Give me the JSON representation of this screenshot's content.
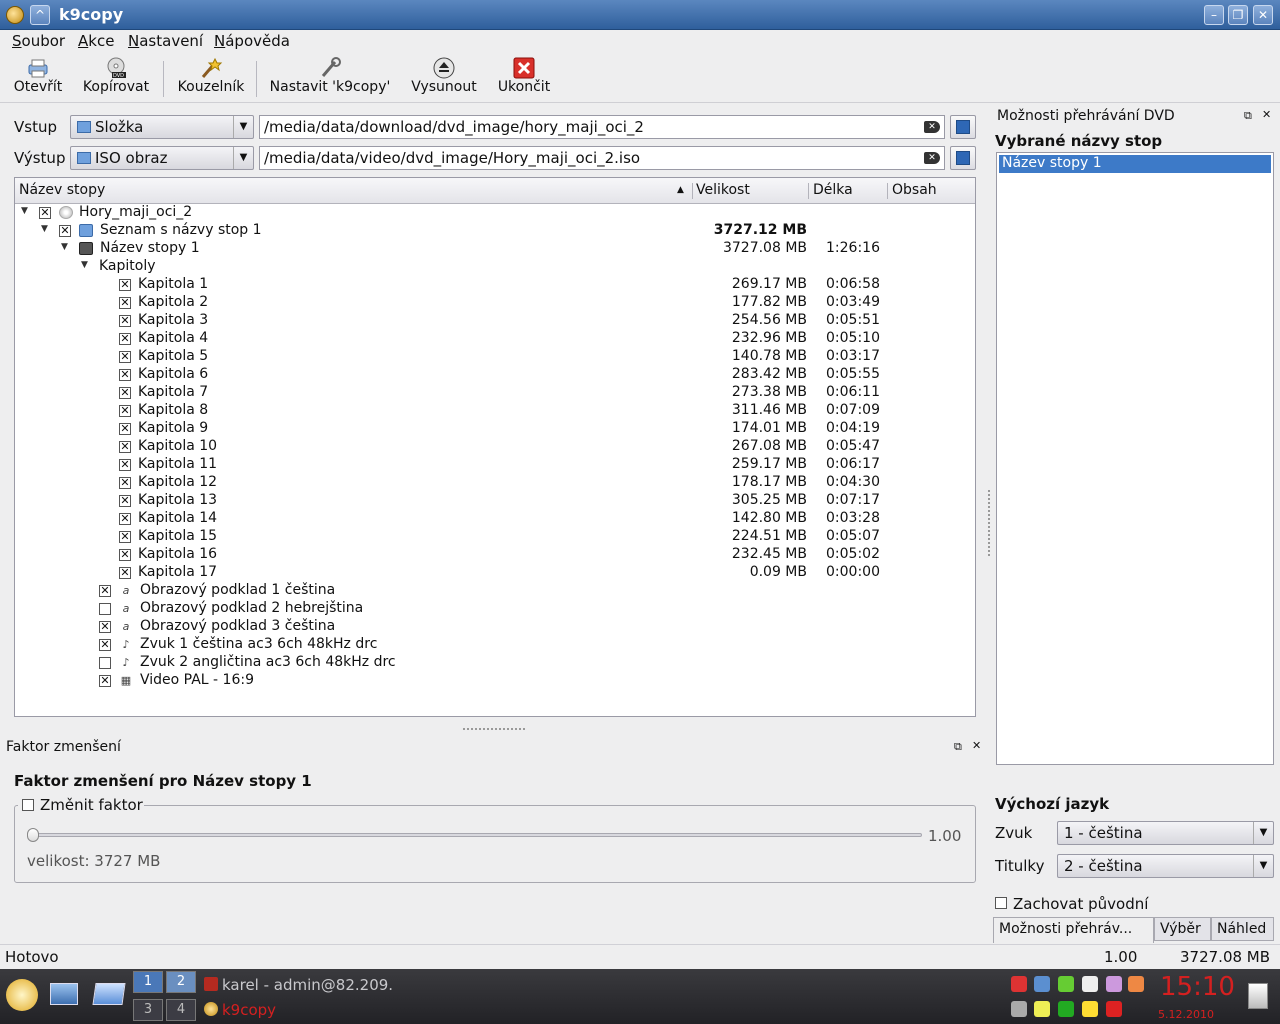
{
  "window": {
    "title": "k9copy"
  },
  "menu": [
    "Soubor",
    "Akce",
    "Nastavení",
    "Nápověda"
  ],
  "toolbar": {
    "open": "Otevřít",
    "copy": "Kopírovat",
    "wizard": "Kouzelník",
    "configure": "Nastavit 'k9copy'",
    "eject": "Vysunout",
    "quit": "Ukončit"
  },
  "io": {
    "input_label": "Vstup",
    "input_type": "Složka",
    "input_path": "/media/data/download/dvd_image/hory_maji_oci_2",
    "output_label": "Výstup",
    "output_type": "ISO obraz",
    "output_path": "/media/data/video/dvd_image/Hory_maji_oci_2.iso"
  },
  "tree": {
    "headers": {
      "name": "Název stopy",
      "size": "Velikost",
      "length": "Délka",
      "content": "Obsah"
    },
    "root": "Hory_maji_oci_2",
    "titleset": {
      "name": "Seznam s názvy stop 1",
      "size": "3727.12 MB"
    },
    "title": {
      "name": "Název stopy 1",
      "size": "3727.08 MB",
      "length": "1:26:16"
    },
    "chapters_label": "Kapitoly",
    "chapters": [
      {
        "name": "Kapitola 1",
        "size": "269.17 MB",
        "length": "0:06:58"
      },
      {
        "name": "Kapitola 2",
        "size": "177.82 MB",
        "length": "0:03:49"
      },
      {
        "name": "Kapitola 3",
        "size": "254.56 MB",
        "length": "0:05:51"
      },
      {
        "name": "Kapitola 4",
        "size": "232.96 MB",
        "length": "0:05:10"
      },
      {
        "name": "Kapitola 5",
        "size": "140.78 MB",
        "length": "0:03:17"
      },
      {
        "name": "Kapitola 6",
        "size": "283.42 MB",
        "length": "0:05:55"
      },
      {
        "name": "Kapitola 7",
        "size": "273.38 MB",
        "length": "0:06:11"
      },
      {
        "name": "Kapitola 8",
        "size": "311.46 MB",
        "length": "0:07:09"
      },
      {
        "name": "Kapitola 9",
        "size": "174.01 MB",
        "length": "0:04:19"
      },
      {
        "name": "Kapitola 10",
        "size": "267.08 MB",
        "length": "0:05:47"
      },
      {
        "name": "Kapitola 11",
        "size": "259.17 MB",
        "length": "0:06:17"
      },
      {
        "name": "Kapitola 12",
        "size": "178.17 MB",
        "length": "0:04:30"
      },
      {
        "name": "Kapitola 13",
        "size": "305.25 MB",
        "length": "0:07:17"
      },
      {
        "name": "Kapitola 14",
        "size": "142.80 MB",
        "length": "0:03:28"
      },
      {
        "name": "Kapitola 15",
        "size": "224.51 MB",
        "length": "0:05:07"
      },
      {
        "name": "Kapitola 16",
        "size": "232.45 MB",
        "length": "0:05:02"
      },
      {
        "name": "Kapitola 17",
        "size": "0.09 MB",
        "length": "0:00:00"
      }
    ],
    "streams": [
      {
        "name": "Obrazový podklad 1 čeština",
        "checked": true
      },
      {
        "name": "Obrazový podklad 2 hebrejština",
        "checked": false
      },
      {
        "name": "Obrazový podklad 3 čeština",
        "checked": true
      },
      {
        "name": "Zvuk 1 čeština ac3 6ch 48kHz drc",
        "checked": true
      },
      {
        "name": "Zvuk 2 angličtina ac3 6ch 48kHz drc",
        "checked": false
      },
      {
        "name": "Video PAL  - 16:9",
        "checked": true
      }
    ]
  },
  "factor": {
    "dock_title": "Faktor zmenšení",
    "heading": "Faktor zmenšení pro Název stopy 1",
    "change_label": "Změnit faktor",
    "value": "1.00",
    "size_text": "velikost: 3727 MB"
  },
  "dvd_options": {
    "dock_title": "Možnosti přehrávání DVD",
    "selected_heading": "Vybrané názvy stop",
    "selected_title": "Název stopy 1",
    "default_lang_heading": "Výchozí jazyk",
    "audio_label": "Zvuk",
    "audio_value": "1 - čeština",
    "subs_label": "Titulky",
    "subs_value": "2 - čeština",
    "keep_menu": "Zachovat původní menu",
    "tabs": [
      "Možnosti přehráv...",
      "Výběr",
      "Náhled"
    ]
  },
  "status": {
    "text": "Hotovo",
    "factor": "1.00",
    "size": "3727.08 MB"
  },
  "taskbar": {
    "pager": [
      "1",
      "2",
      "3",
      "4"
    ],
    "tasks": [
      "karel - admin@82.209.",
      "k9copy"
    ],
    "clock_time": "15:10",
    "clock_date": "5.12.2010"
  }
}
